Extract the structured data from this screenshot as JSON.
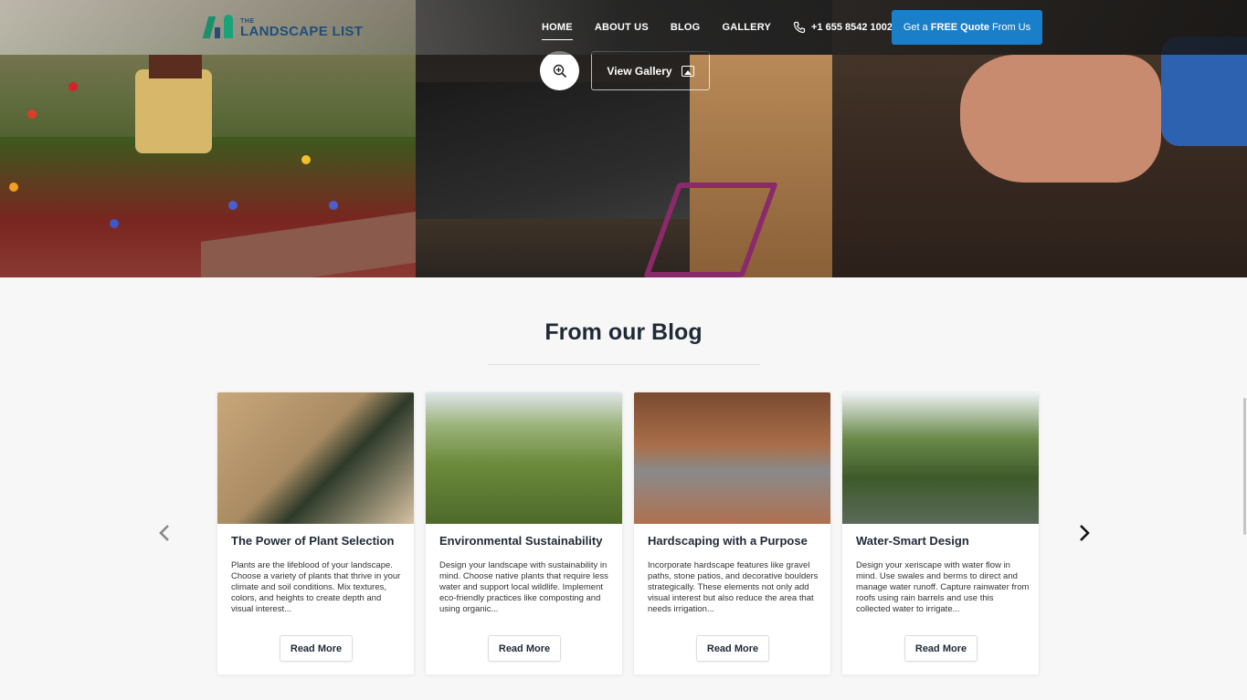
{
  "header": {
    "logo": {
      "small": "THE",
      "big": "LANDSCAPE LIST"
    },
    "nav": [
      {
        "label": "HOME"
      },
      {
        "label": "ABOUT US"
      },
      {
        "label": "BLOG"
      },
      {
        "label": "GALLERY"
      }
    ],
    "phone": "+1 655 8542 1002",
    "quote_button": {
      "prefix": "Get a",
      "bold": "FREE Quote",
      "suffix": "From Us"
    }
  },
  "gallery": {
    "view_label": "View Gallery",
    "icons": {
      "zoom": "zoom-in-icon",
      "view": "image-icon"
    }
  },
  "blog": {
    "title": "From our Blog",
    "cards": [
      {
        "title": "The Power of Plant Selection",
        "text": "Plants are the lifeblood of your landscape. Choose a variety of plants that thrive in your climate and soil conditions. Mix textures, colors, and heights to create depth and visual interest...",
        "button": "Read More"
      },
      {
        "title": "Environmental Sustainability",
        "text": "Design your landscape with sustainability in mind. Choose native plants that require less water and support local wildlife. Implement eco-friendly practices like composting and using organic...",
        "button": "Read More"
      },
      {
        "title": "Hardscaping with a Purpose",
        "text": "Incorporate hardscape features like gravel paths, stone patios, and decorative boulders strategically. These elements not only add visual interest but also reduce the area that needs irrigation...",
        "button": "Read More"
      },
      {
        "title": "Water-Smart Design",
        "text": "Design your xeriscape with water flow in mind. Use swales and berms to direct and manage water runoff. Capture rainwater from roofs using rain barrels and use this collected water to irrigate...",
        "button": "Read More"
      }
    ]
  },
  "colors": {
    "accent": "#1a7fc9",
    "logo": "#1f4e79",
    "heading": "#1f2a37"
  },
  "icons": [
    "chevron-left-icon",
    "chevron-right-icon",
    "phone-icon"
  ]
}
